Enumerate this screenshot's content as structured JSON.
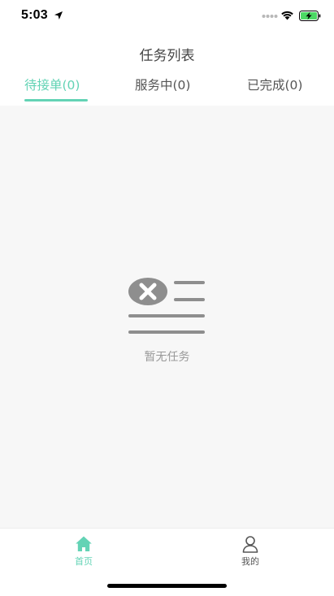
{
  "status_bar": {
    "time": "5:03",
    "icons": [
      "location-arrow-icon",
      "signal-icon",
      "wifi-icon",
      "battery-charging-icon"
    ]
  },
  "header": {
    "title": "任务列表"
  },
  "tabs": [
    {
      "label": "待接单(0)",
      "active": true
    },
    {
      "label": "服务中(0)",
      "active": false
    },
    {
      "label": "已完成(0)",
      "active": false
    }
  ],
  "main": {
    "empty_icon": "empty-list-icon",
    "empty_text": "暂无任务"
  },
  "bottom_nav": [
    {
      "label": "首页",
      "icon": "home-icon",
      "active": true
    },
    {
      "label": "我的",
      "icon": "user-icon",
      "active": false
    }
  ],
  "colors": {
    "accent": "#63d3b5",
    "content_bg": "#f7f7f7",
    "muted_text": "#999999",
    "battery_green": "#4cd964"
  }
}
